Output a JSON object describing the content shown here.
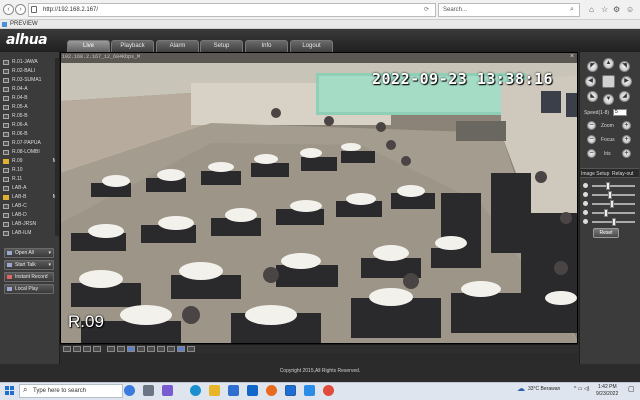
{
  "browser": {
    "url": "http://192.168.2.167/",
    "search_placeholder": "Search...",
    "tab_title": "PREVIEW"
  },
  "app": {
    "logo": "alhua",
    "tabs": [
      {
        "label": "Live",
        "active": true
      },
      {
        "label": "Playback",
        "active": false
      },
      {
        "label": "Alarm",
        "active": false
      },
      {
        "label": "Setup",
        "active": false
      },
      {
        "label": "Info",
        "active": false
      },
      {
        "label": "Logout",
        "active": false
      }
    ]
  },
  "cameras": [
    {
      "label": "R.01-JAWA",
      "on": false,
      "flag": ""
    },
    {
      "label": "R.02-BALI",
      "on": false,
      "flag": ""
    },
    {
      "label": "R.03-SUMA1",
      "on": false,
      "flag": ""
    },
    {
      "label": "R.04-A",
      "on": false,
      "flag": ""
    },
    {
      "label": "R.04-B",
      "on": false,
      "flag": ""
    },
    {
      "label": "R.05-A",
      "on": false,
      "flag": ""
    },
    {
      "label": "R.05-B",
      "on": false,
      "flag": ""
    },
    {
      "label": "R.06-A",
      "on": false,
      "flag": ""
    },
    {
      "label": "R.06-B",
      "on": false,
      "flag": ""
    },
    {
      "label": "R.07-PAPUA",
      "on": false,
      "flag": ""
    },
    {
      "label": "R.08-LOMBI",
      "on": false,
      "flag": ""
    },
    {
      "label": "R.09",
      "on": true,
      "flag": "M"
    },
    {
      "label": "R.10",
      "on": false,
      "flag": ""
    },
    {
      "label": "R.11",
      "on": false,
      "flag": ""
    },
    {
      "label": "LAB-A",
      "on": false,
      "flag": ""
    },
    {
      "label": "LAB-B",
      "on": true,
      "flag": "M"
    },
    {
      "label": "LAB-C",
      "on": false,
      "flag": ""
    },
    {
      "label": "LAB-D",
      "on": false,
      "flag": ""
    },
    {
      "label": "LAB-JRSN",
      "on": false,
      "flag": ""
    },
    {
      "label": "LAB-ILM",
      "on": false,
      "flag": ""
    }
  ],
  "side_buttons": {
    "open_all": "Open All",
    "start_talk": "Start Talk",
    "instant_record": "Instant Record",
    "local_play": "Local Play"
  },
  "video": {
    "info": "192.168.2.167_12_684Kbps_M",
    "timestamp": "2022-09-23 13:38:16",
    "channel_name": "R.09"
  },
  "ptz": {
    "speed_label": "Speed(1-8)",
    "speed_value": "5",
    "zoom_label": "Zoom",
    "focus_label": "Focus",
    "iris_label": "Iris",
    "image_setup_label": "Image Setup",
    "relay_out_label": "Relay-out",
    "sliders": [
      0.35,
      0.4,
      0.45,
      0.3,
      0.5
    ],
    "reset_label": "Reset"
  },
  "footer": {
    "copyright": "Copyright 2015,All Rights Reserved."
  },
  "taskbar": {
    "search_placeholder": "Type here to search",
    "weather": "33°C  Berawan",
    "time": "1:42 PM",
    "date": "9/23/2022"
  }
}
